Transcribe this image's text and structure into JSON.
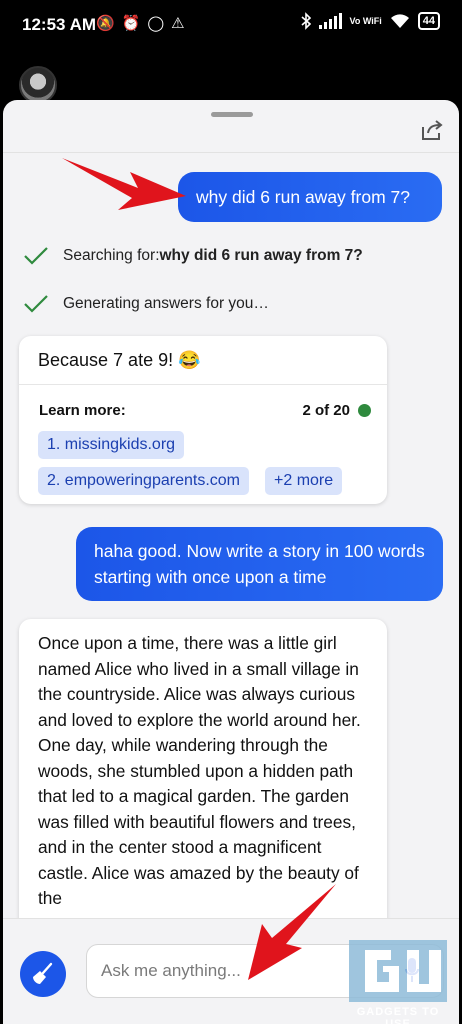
{
  "status_bar": {
    "time": "12:53 AM",
    "battery": "44",
    "network_label": "Vo WiFi"
  },
  "chat": {
    "messages": [
      {
        "role": "user",
        "text": "why did 6 run away from 7?"
      },
      {
        "role": "user",
        "text": "haha good. Now write a story in 100 words starting with once upon a time"
      }
    ],
    "progress": [
      {
        "prefix": "Searching for: ",
        "query": "why did 6 run away from 7?"
      },
      {
        "prefix": "Generating answers for you…",
        "query": ""
      }
    ],
    "answer": {
      "text": "Because 7 ate 9! 😂",
      "learn_more_label": "Learn more:",
      "count": "2 of 20",
      "sources": [
        "1. missingkids.org",
        "2. empoweringparents.com"
      ],
      "more": "+2 more"
    },
    "story": "Once upon a time, there was a little girl named Alice who lived in a small village in the countryside. Alice was always curious and loved to explore the world around her. One day, while wandering through the woods, she stumbled upon a hidden path that led to a magical garden. The garden was filled with beautiful flowers and trees, and in the center stood a magnificent castle. Alice was amazed by the beauty of the"
  },
  "input": {
    "placeholder": "Ask me anything..."
  },
  "watermark": {
    "text": "GADGETS TO USE"
  },
  "colors": {
    "accent": "#1c56e8",
    "chip_bg": "#d9e3fb",
    "check": "#2f8a3e",
    "annotation_arrow": "#e0141c"
  },
  "icons": [
    "share-icon",
    "check-icon",
    "broom-icon",
    "mic-icon",
    "bluetooth-icon",
    "wifi-icon",
    "alarm-icon",
    "whatsapp-icon",
    "warning-icon",
    "mute-icon"
  ]
}
